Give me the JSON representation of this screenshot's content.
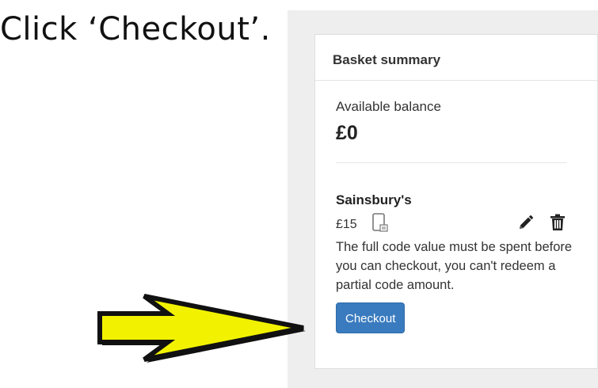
{
  "instruction": {
    "text": "Click ‘Checkout’."
  },
  "basket": {
    "title": "Basket summary",
    "balance_label": "Available balance",
    "balance_value": "£0",
    "item": {
      "merchant": "Sainsbury's",
      "price": "£15",
      "device_icon": "mobile-device-icon",
      "edit_icon": "pencil-icon",
      "delete_icon": "trash-icon",
      "note": "The full code value must be spent before you can checkout, you can't redeem a partial code amount."
    },
    "checkout_label": "Checkout"
  },
  "colors": {
    "button": "#3a7bbf",
    "arrow_fill": "#f2f200",
    "arrow_outline": "#111111",
    "panel_bg": "#eeeeee"
  }
}
